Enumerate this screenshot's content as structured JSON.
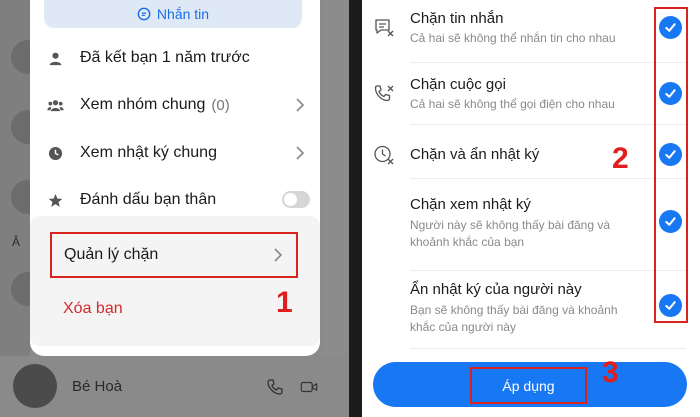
{
  "left": {
    "message_button": "Nhắn tin",
    "menu": [
      {
        "label": "Đã kết bạn 1 năm trước",
        "icon": "person-icon"
      },
      {
        "label": "Xem nhóm chung",
        "count": "(0)",
        "icon": "group-icon"
      },
      {
        "label": "Xem nhật ký chung",
        "icon": "clock-icon"
      },
      {
        "label": "Đánh dấu bạn thân",
        "icon": "star-icon"
      }
    ],
    "block_label": "Quản lý chặn",
    "delete_label": "Xóa bạn",
    "background_letter": "Â",
    "contact_name": "Bé Hoà"
  },
  "annotations": {
    "step1": "1",
    "step2": "2",
    "step3": "3",
    "color": "#d9231f"
  },
  "right": {
    "options": [
      {
        "title": "Chặn tin nhắn",
        "desc": "Cả hai sẽ không thể nhắn tin cho nhau",
        "icon": "message-block-icon",
        "checked": true
      },
      {
        "title": "Chặn cuộc gọi",
        "desc": "Cả hai sẽ không thể gọi điện cho nhau",
        "icon": "phone-block-icon",
        "checked": true
      },
      {
        "title": "Chặn và ẩn nhật ký",
        "desc": "",
        "icon": "clock-block-icon",
        "checked": true
      },
      {
        "title": "Chặn xem nhật ký",
        "desc": "Người này sẽ không thấy bài đăng và khoảnh khắc của bạn",
        "icon": "",
        "checked": true
      },
      {
        "title": "Ẩn nhật ký của người này",
        "desc": "Bạn sẽ không thấy bài đăng và khoảnh khắc của người này",
        "icon": "",
        "checked": true
      }
    ],
    "apply_label": "Áp dụng",
    "accent": "#1877f2"
  }
}
